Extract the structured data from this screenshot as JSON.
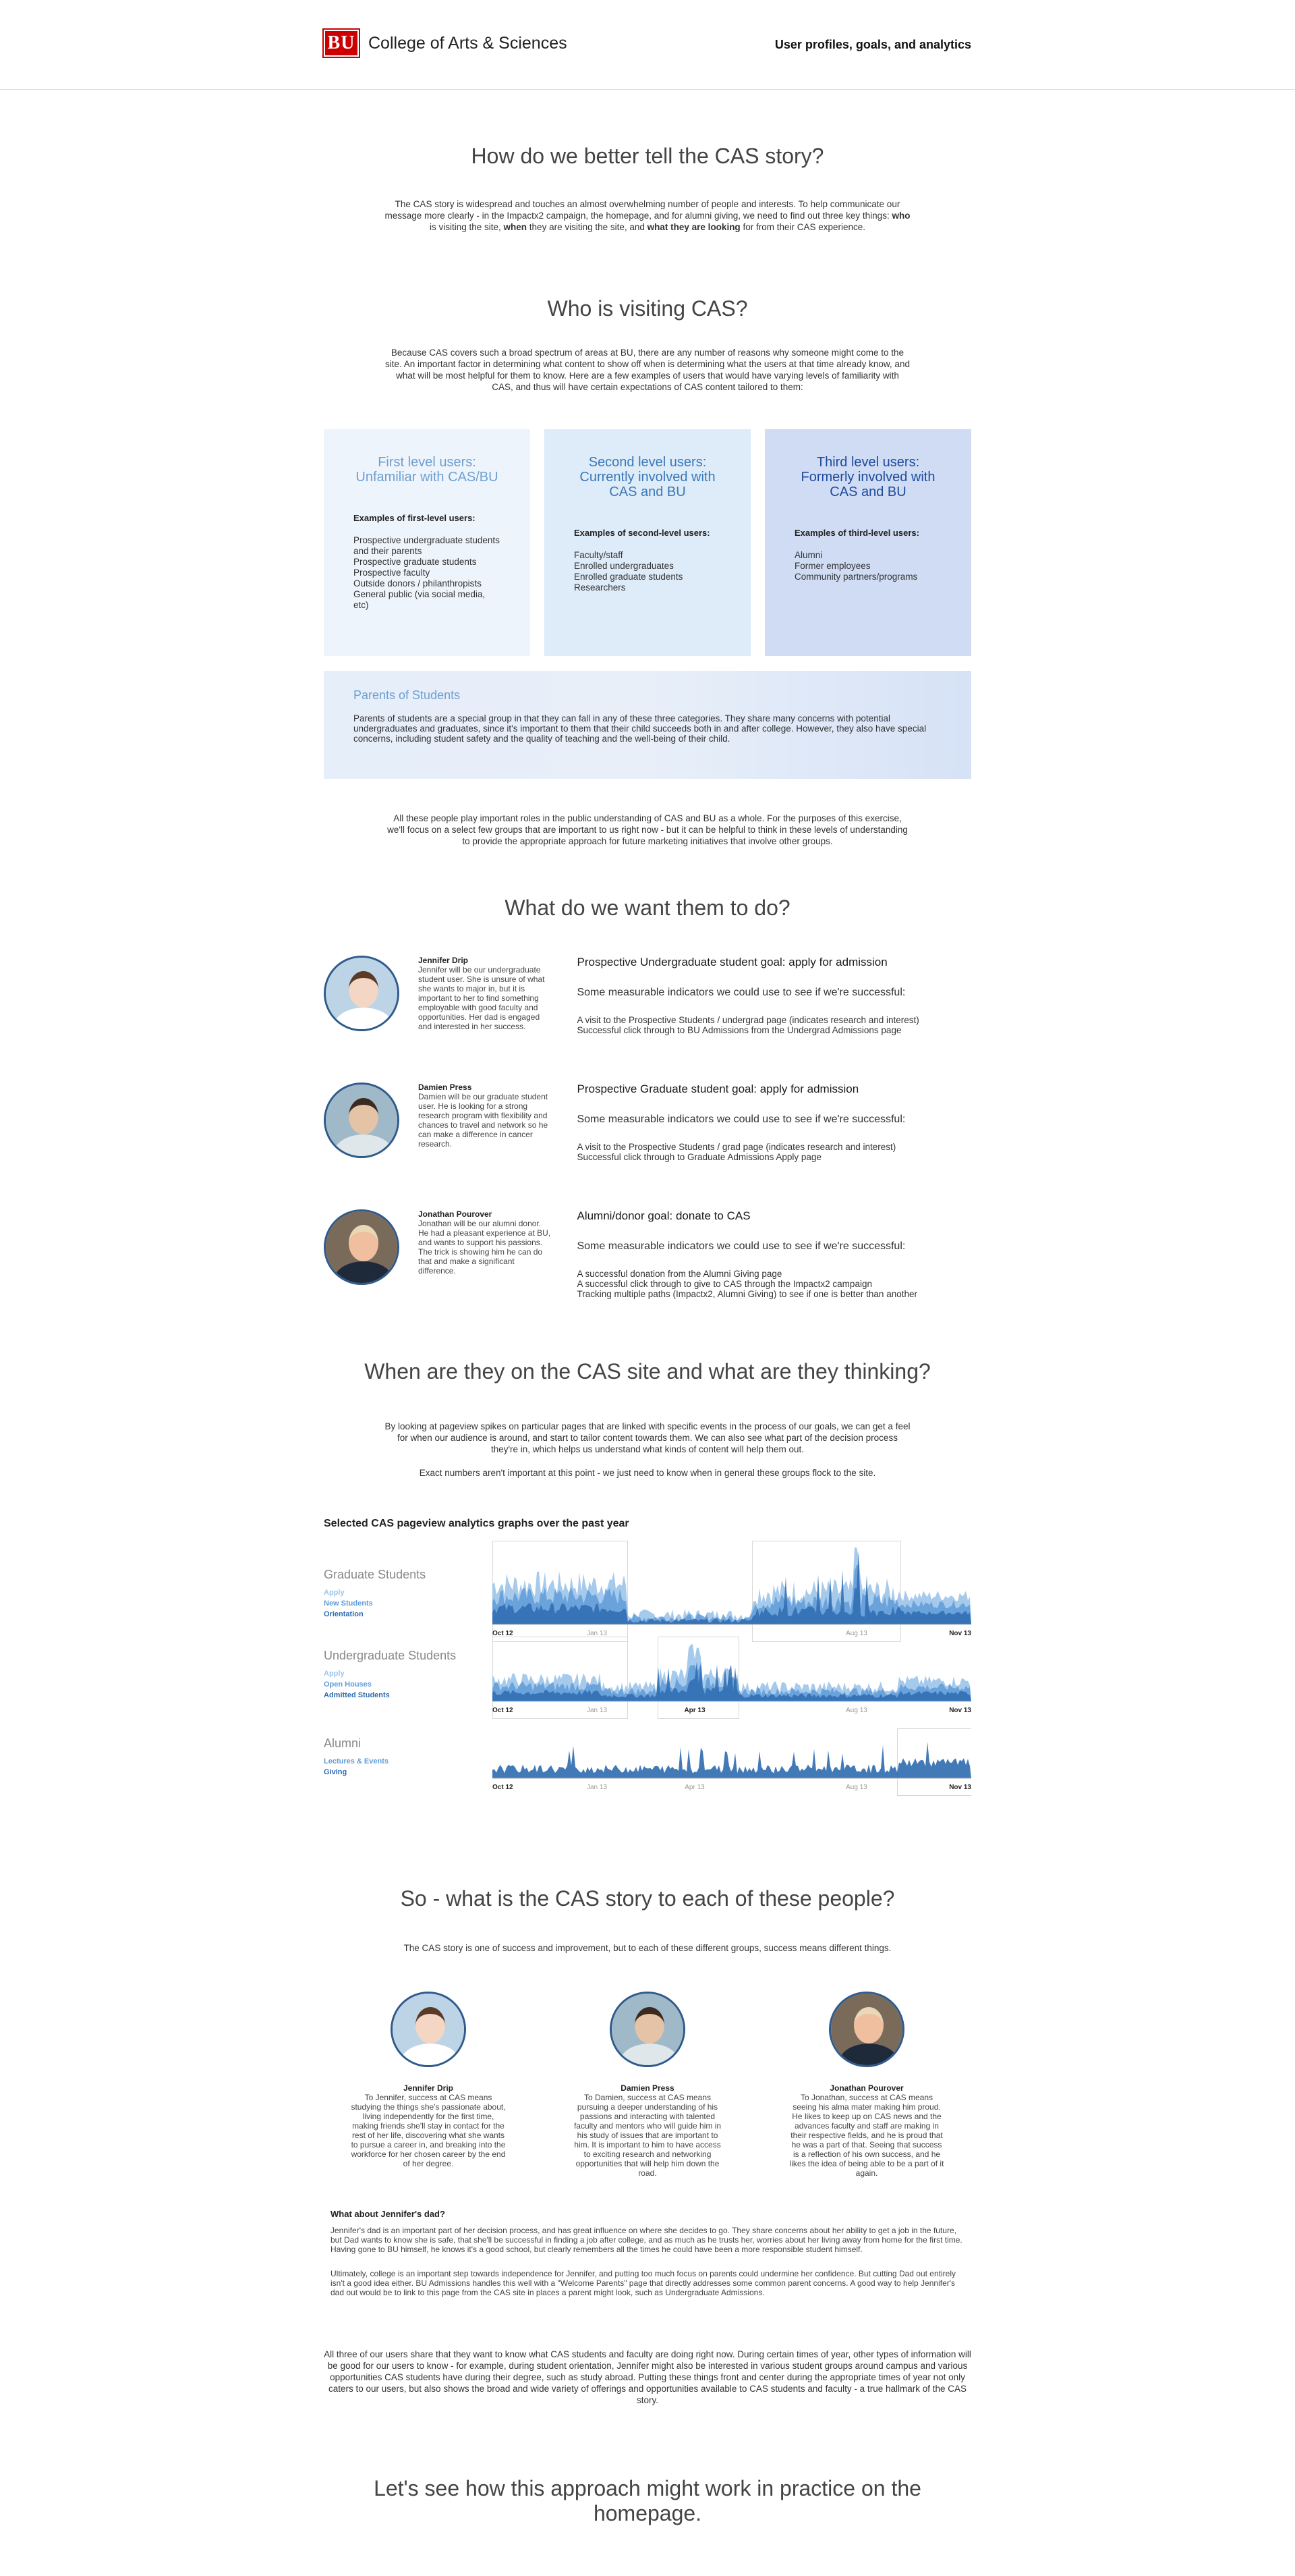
{
  "header": {
    "logo_badge": "BU",
    "logo_text": "College of Arts & Sciences",
    "right_title": "User profiles, goals, and analytics"
  },
  "s1": {
    "title": "How do we better tell the CAS story?",
    "p1": "The CAS story is widespread and touches an almost overwhelming number of people and interests. To help communicate our message more clearly - in the Impactx2 campaign, the homepage, and for alumni giving, we need to find out three key things: ",
    "b1": "who",
    "p2": " is visiting the site, ",
    "b2": "when",
    "p3": " they are visiting the site, and ",
    "b3": "what they are looking",
    "p4": " for from their CAS experience."
  },
  "s2": {
    "title": "Who is visiting CAS?",
    "intro": "Because CAS covers such a broad spectrum of areas at BU, there are any number of reasons why someone might come to the site. An important factor in determining what content to show off when is determining what the users at that time already know, and what will be most helpful for them to know. Here are a few examples of users that would have varying levels of familiarity with CAS, and thus will have certain expectations of CAS content tailored to them:",
    "cards": [
      {
        "title": "First level users: Unfamiliar with CAS/BU",
        "label": "Examples of first-level users:",
        "items": [
          "Prospective undergraduate students and their parents",
          "Prospective graduate students",
          "Prospective faculty",
          "Outside donors / philanthropists",
          "General public (via social media, etc)"
        ],
        "bg": "#eef4fc",
        "color": "#6d9fcf"
      },
      {
        "title": "Second level users: Currently involved with CAS and BU",
        "label": "Examples of second-level users:",
        "items": [
          "Faculty/staff",
          "Enrolled undergraduates",
          "Enrolled graduate students",
          "Researchers"
        ],
        "bg": "#deebf8",
        "color": "#3a78b7"
      },
      {
        "title": "Third level users: Formerly involved with CAS and BU",
        "label": "Examples of third-level users:",
        "items": [
          "Alumni",
          "Former employees",
          "Community partners/programs"
        ],
        "bg": "#cfdcf4",
        "color": "#1d4a9a"
      }
    ],
    "parents_title": "Parents of Students",
    "parents_text": "Parents of students are a special group in that they can fall in any of these three categories. They share many concerns with potential undergraduates and graduates, since it's important to them that their child succeeds both in and after college. However, they also have special concerns, including student safety and the quality of teaching and the well-being of their child.",
    "outro": "All these people play important roles in the public understanding of CAS and BU as a whole. For the purposes of this exercise, we'll focus on a select few groups that are important to us right now - but it can be helpful to think in these levels of understanding to provide the appropriate approach for future marketing initiatives that involve other groups."
  },
  "s3": {
    "title": "What do we want them to do?",
    "personas": [
      {
        "name": "Jennifer Drip",
        "bio": "Jennifer will be our undergraduate student user. She is unsure of what she wants to major in, but it is important to her to find something employable with good faculty and opportunities. Her dad is engaged and interested in her success.",
        "goal": "Prospective Undergraduate student goal: apply for admission",
        "sub": "Some measurable indicators we could use to see if we're successful:",
        "items": [
          "A visit to the Prospective Students / undergrad page (indicates research and interest)",
          "Successful click through to BU Admissions from the Undergrad Admissions page"
        ]
      },
      {
        "name": "Damien Press",
        "bio": "Damien will be our graduate student user. He is looking for a strong research program with flexibility and chances to travel and network so he can make a difference in cancer research.",
        "goal": "Prospective Graduate student goal: apply for admission",
        "sub": "Some measurable indicators we could use to see if we're successful:",
        "items": [
          "A visit to the Prospective Students / grad page (indicates research and interest)",
          "Successful click through to Graduate Admissions Apply page"
        ]
      },
      {
        "name": "Jonathan Pourover",
        "bio": "Jonathan will be our alumni donor. He had a pleasant experience at BU, and wants to support his passions. The trick is showing him he can do that and make a significant difference.",
        "goal": "Alumni/donor goal: donate to CAS",
        "sub": "Some measurable indicators we could use to see if we're successful:",
        "items": [
          "A successful donation from the Alumni Giving page",
          "A successful click through to give to CAS through the Impactx2 campaign",
          "Tracking multiple paths (Impactx2, Alumni Giving) to see if one is better than another"
        ]
      }
    ]
  },
  "s4": {
    "title": "When are they on the CAS site and what are they thinking?",
    "p1": "By looking at pageview spikes on particular pages that are linked with specific events in the process of our goals, we can get a feel for when our audience is around, and start to tailor content towards them. We can also see what part of the decision process they're in, which helps us understand what kinds of content will help them out.",
    "p2": "Exact numbers aren't important at this point - we just need to know when in general these groups flock to the site.",
    "charts_title": "Selected CAS pageview analytics graphs over the past year"
  },
  "charts": [
    {
      "label": "Graduate Students",
      "legend": [
        {
          "text": "Apply",
          "color": "#9cc4ea"
        },
        {
          "text": "New Students",
          "color": "#5f9bd8"
        },
        {
          "text": "Orientation",
          "color": "#2d6bb0"
        }
      ],
      "ticks": [
        {
          "text": "Oct 12",
          "bold": true
        },
        {
          "text": "Jan 13",
          "bold": false
        },
        {
          "text": "Aug 13",
          "bold": false
        },
        {
          "text": "Nov 13",
          "bold": true
        }
      ]
    },
    {
      "label": "Undergraduate Students",
      "legend": [
        {
          "text": "Apply",
          "color": "#9cc4ea"
        },
        {
          "text": "Open Houses",
          "color": "#5f9bd8"
        },
        {
          "text": "Admitted Students",
          "color": "#2d6bb0"
        }
      ],
      "ticks": [
        {
          "text": "Oct 12",
          "bold": true
        },
        {
          "text": "Jan 13",
          "bold": false
        },
        {
          "text": "Apr 13",
          "bold": true
        },
        {
          "text": "Aug 13",
          "bold": false
        },
        {
          "text": "Nov 13",
          "bold": true
        }
      ]
    },
    {
      "label": "Alumni",
      "legend": [
        {
          "text": "Lectures & Events",
          "color": "#5f9bd8"
        },
        {
          "text": "Giving",
          "color": "#2d6bb0"
        }
      ],
      "ticks": [
        {
          "text": "Oct 12",
          "bold": true
        },
        {
          "text": "Jan 13",
          "bold": false
        },
        {
          "text": "Apr 13",
          "bold": false
        },
        {
          "text": "Aug 13",
          "bold": false
        },
        {
          "text": "Nov 13",
          "bold": true
        }
      ]
    }
  ],
  "s5": {
    "title": "So - what is the CAS story to each of these people?",
    "intro": "The CAS story is one of success and improvement, but to each of these different groups, success means different things.",
    "people": [
      {
        "name": "Jennifer Drip",
        "text": "To Jennifer, success at CAS means studying the things she's passionate about, living independently for the first time, making friends she'll stay in contact for the rest of her life, discovering what she wants to pursue a career in, and breaking into the workforce for her chosen career by the end of her degree."
      },
      {
        "name": "Damien Press",
        "text": "To Damien, success at CAS means pursuing a deeper understanding of his passions and interacting with talented faculty and mentors who will guide him in his study of issues that are important to him. It is important to him to have access to exciting research and networking opportunities that will help him down the road."
      },
      {
        "name": "Jonathan Pourover",
        "text": "To Jonathan, success at CAS means seeing his alma mater making him proud. He likes to keep up on CAS news and the advances faculty and staff are making in their respective fields, and he is proud that he was a part of that. Seeing that success is a reflection of his own success, and he likes the idea of being able to be a part of it again."
      }
    ],
    "dad_title": "What about Jennifer's dad?",
    "dad_p1": "Jennifer's dad is an important part of her decision process, and has great influence on where she decides to go. They share concerns about her ability to get a job in the future, but Dad wants to know she is safe, that she'll be successful in finding a job after college, and as much as he trusts her, worries about her living away from home for the first time. Having gone to BU himself, he knows it's a good school, but clearly remembers all the times he could have been a more responsible student himself.",
    "dad_p2": "Ultimately, college is an important step towards independence for Jennifer, and putting too much focus on parents could undermine her confidence. But cutting Dad out entirely isn't a good idea either. BU Admissions handles this well with a \"Welcome Parents\" page that directly addresses some common parent concerns. A good way to help Jennifer's dad out would be to link to this page from the CAS site in places a parent might look, such as Undergraduate Admissions.",
    "outro": "All three of our users share that they want to know what CAS students and faculty are doing right now. During certain times of year, other types of information will be good for our users to know - for example, during student orientation, Jennifer might also be interested in various student groups around campus and various opportunities CAS students have during their degree, such as study abroad. Putting these things front and center during the appropriate times of year not only caters to our users, but also shows the broad and wide variety of offerings and opportunities available to CAS students and faculty - a true hallmark of the CAS story."
  },
  "s6": {
    "title": "Let's see how this approach might work in practice on the homepage."
  }
}
